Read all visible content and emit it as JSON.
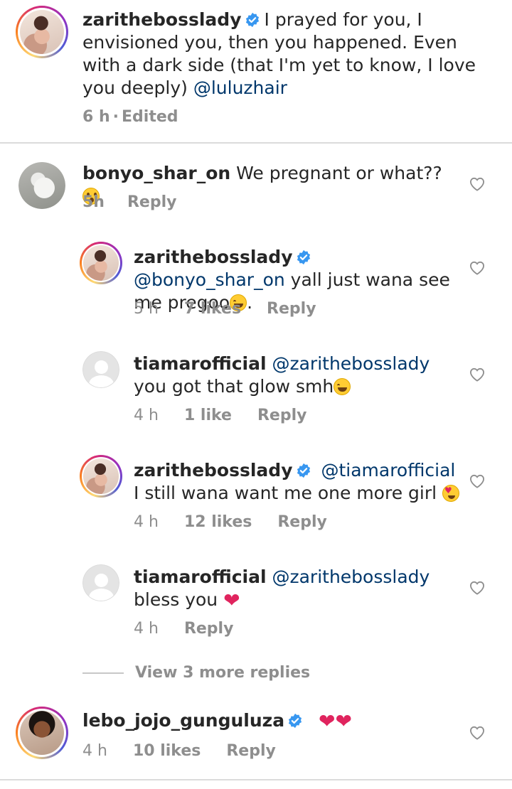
{
  "caption": {
    "username": "zarithebosslady",
    "text_before": "I prayed for you, I envisioned you, then you happened. Even with a dark side (that I'm yet to know, I love you deeply) ",
    "mention": "@luluzhair",
    "time": "6 h",
    "separator": "·",
    "edited": "Edited"
  },
  "comments": [
    {
      "username": "bonyo_shar_on",
      "text": "We pregnant or what??",
      "emoji": "astonished-emoji",
      "time": "5h",
      "reply": "Reply"
    },
    {
      "username": "zarithebosslady",
      "mention": "@bonyo_shar_on",
      "text": "yall just wana see me pregoo",
      "emoji": "grinning-sweat-emoji",
      "text_after": ".",
      "time": "5 h",
      "likes": "7 likes",
      "reply": "Reply"
    },
    {
      "username": "tiamarofficial",
      "mention": "@zarithebosslady",
      "text": " you got that glow smh",
      "emoji": "grinning-sweat-emoji",
      "time": "4 h",
      "likes": "1 like",
      "reply": "Reply"
    },
    {
      "username": "zarithebosslady",
      "mention": "@tiamarofficial",
      "text": " I still wana want me one more girl",
      "emoji": "heart-eyes-emoji",
      "time": "4 h",
      "likes": "12 likes",
      "reply": "Reply"
    },
    {
      "username": "tiamarofficial",
      "mention": "@zarithebosslady",
      "text": "bless you",
      "emoji": "red-heart-emoji",
      "time": "4 h",
      "reply": "Reply"
    }
  ],
  "view_more": "View 3 more replies",
  "last_comment": {
    "username": "lebo_jojo_gunguluza",
    "text": "❤❤",
    "time": "4 h",
    "likes": "10 likes",
    "reply": "Reply"
  },
  "icons": {
    "like": "heart-outline-icon",
    "verified": "verified-badge-icon"
  },
  "colors": {
    "mention": "#00376b",
    "verified": "#3897f0",
    "meta": "#8e8e8e"
  }
}
